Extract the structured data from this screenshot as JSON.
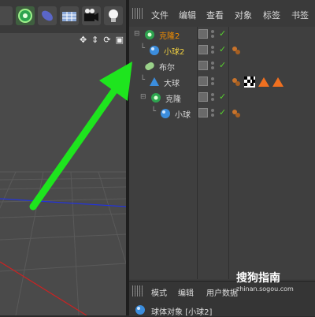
{
  "object_manager": {
    "menu": [
      "文件",
      "编辑",
      "查看",
      "对象",
      "标签",
      "书签"
    ],
    "tree": [
      {
        "label": "克隆2",
        "depth": 0,
        "icon": "cloner-icon",
        "color": "#f08c00",
        "checked": true
      },
      {
        "label": "小球2",
        "depth": 1,
        "icon": "sphere-icon",
        "color": "#f0d040",
        "checked": true,
        "selected": true
      },
      {
        "label": "布尔",
        "depth": 0,
        "icon": "boole-icon",
        "color": "#d8d8d8",
        "checked": true
      },
      {
        "label": "大球",
        "depth": 1,
        "icon": "cone-icon",
        "color": "#d8d8d8",
        "checked": false
      },
      {
        "label": "克隆",
        "depth": 0,
        "icon": "cloner-icon",
        "color": "#d8d8d8",
        "checked": true
      },
      {
        "label": "小球",
        "depth": 1,
        "icon": "sphere-icon",
        "color": "#d8d8d8",
        "checked": true
      }
    ]
  },
  "attributes": {
    "menu": [
      "模式",
      "编辑",
      "用户数据"
    ],
    "title": "球体对象 [小球2]"
  },
  "watermark": {
    "main": "搜狗指南",
    "sub": "zhinan.sogou.com"
  },
  "colors": {
    "arrow": "#1ee51e",
    "accent": "#f08c00",
    "check": "#58d22e"
  }
}
